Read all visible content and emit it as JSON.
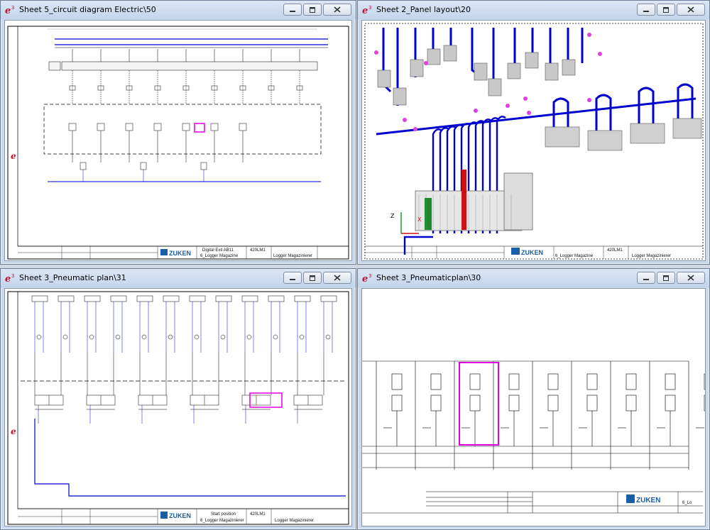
{
  "app": {
    "accent": "#0000cc",
    "highlight": "#e000e0",
    "brand_color": "#1a5ea8"
  },
  "windows": [
    {
      "title": "Sheet 5_circuit diagram Electric\\50",
      "titleblock": {
        "line1": "Digital Exit AB11",
        "line2": "6_Logger Magazine",
        "code": "420LM1",
        "right": "Logger Magazinierer"
      }
    },
    {
      "title": "Sheet 2_Panel layout\\20",
      "titleblock": {
        "line1": "",
        "line2": "6_Logger Magazine",
        "code": "420LM1",
        "right": "Logger Magazinierer"
      },
      "axis": {
        "z": "Z",
        "x": "X"
      }
    },
    {
      "title": "Sheet 3_Pneumatic plan\\31",
      "titleblock": {
        "line1": "Start position",
        "line2": "6_Logger Magazinierer",
        "code": "420LM1",
        "right": "Logger Magazinierer"
      }
    },
    {
      "title": "Sheet 3_Pneumaticplan\\30",
      "titleblock": {
        "line1": "",
        "line2": "6_Lo",
        "code": "",
        "right": ""
      }
    }
  ],
  "brand": {
    "name": "ZUKEN"
  },
  "controls": {
    "minimize": "minimize-icon",
    "maximize": "maximize-icon",
    "close": "close-icon"
  }
}
